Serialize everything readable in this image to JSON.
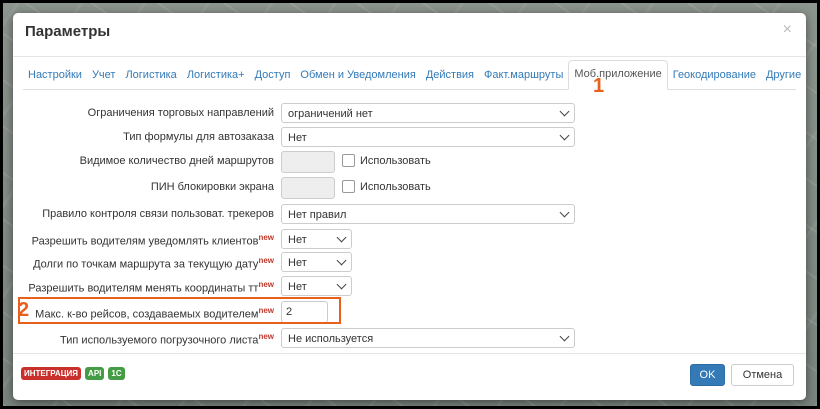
{
  "dialog": {
    "title": "Параметры",
    "close_glyph": "×"
  },
  "tabs": [
    {
      "label": "Настройки"
    },
    {
      "label": "Учет"
    },
    {
      "label": "Логистика"
    },
    {
      "label": "Логистика+"
    },
    {
      "label": "Доступ"
    },
    {
      "label": "Обмен и Уведомления"
    },
    {
      "label": "Действия"
    },
    {
      "label": "Факт.маршруты"
    },
    {
      "label": "Моб.приложение",
      "active": true
    },
    {
      "label": "Геокодирование"
    },
    {
      "label": "Другие"
    }
  ],
  "new_mark": "new",
  "rows": {
    "trade": {
      "label": "Ограничения торговых направлений",
      "value": "ограничений нет"
    },
    "formula": {
      "label": "Тип формулы для автозаказа",
      "value": "Нет"
    },
    "days": {
      "label": "Видимое количество дней маршрутов",
      "checkbox_label": "Использовать"
    },
    "pin": {
      "label": "ПИН блокировки экрана",
      "checkbox_label": "Использовать"
    },
    "trackers": {
      "label": "Правило контроля связи пользоват. трекеров",
      "value": "Нет правил"
    },
    "notify": {
      "label": "Разрешить водителям уведомлять клиентов",
      "value": "Нет"
    },
    "debts": {
      "label": "Долги по точкам маршрута за текущую дату",
      "value": "Нет"
    },
    "coords": {
      "label": "Разрешить водителям менять координаты тт",
      "value": "Нет"
    },
    "trips": {
      "label": "Макс. к-во рейсов, создаваемых водителем",
      "value": "2"
    },
    "sheet": {
      "label": "Тип используемого погрузочного листа",
      "value": "Не используется"
    }
  },
  "annotations": {
    "one": "1",
    "two": "2",
    "color": "#e8601c"
  },
  "footer": {
    "badges": [
      "ИНТЕГРАЦИЯ",
      "API",
      "1С"
    ],
    "ok_label": "OK",
    "cancel_label": "Отмена"
  }
}
